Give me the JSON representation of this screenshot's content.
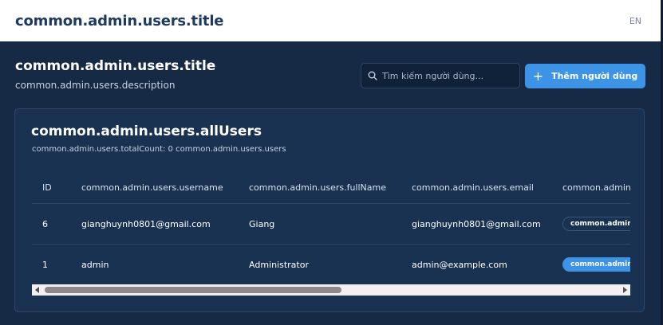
{
  "topbar": {
    "title": "common.admin.users.title",
    "language": "EN"
  },
  "header": {
    "title": "common.admin.users.title",
    "description": "common.admin.users.description"
  },
  "search": {
    "placeholder": "Tìm kiếm người dùng...",
    "value": "",
    "icon": "search-icon"
  },
  "add_button": {
    "icon": "plus-icon",
    "label": "Thêm người dùng"
  },
  "card": {
    "title": "common.admin.users.allUsers",
    "subtitle": "common.admin.users.totalCount: 0 common.admin.users.users"
  },
  "table": {
    "columns": {
      "id": "ID",
      "username": "common.admin.users.username",
      "fullName": "common.admin.users.fullName",
      "email": "common.admin.users.email",
      "role": "common.admin.users.role"
    },
    "rows": [
      {
        "id": "6",
        "username": "gianghuynh0801@gmail.com",
        "fullName": "Giang",
        "email": "gianghuynh0801@gmail.com",
        "role": "common.admin.users.user",
        "role_style": "outline"
      },
      {
        "id": "1",
        "username": "admin",
        "fullName": "Administrator",
        "email": "admin@example.com",
        "role": "common.admin.users.admin",
        "role_style": "filled"
      }
    ]
  },
  "colors": {
    "background": "#172a45",
    "card": "#1a3252",
    "accent": "#3d93e6",
    "topbar": "#ffffff",
    "topbar_title": "#1e3a5f"
  }
}
